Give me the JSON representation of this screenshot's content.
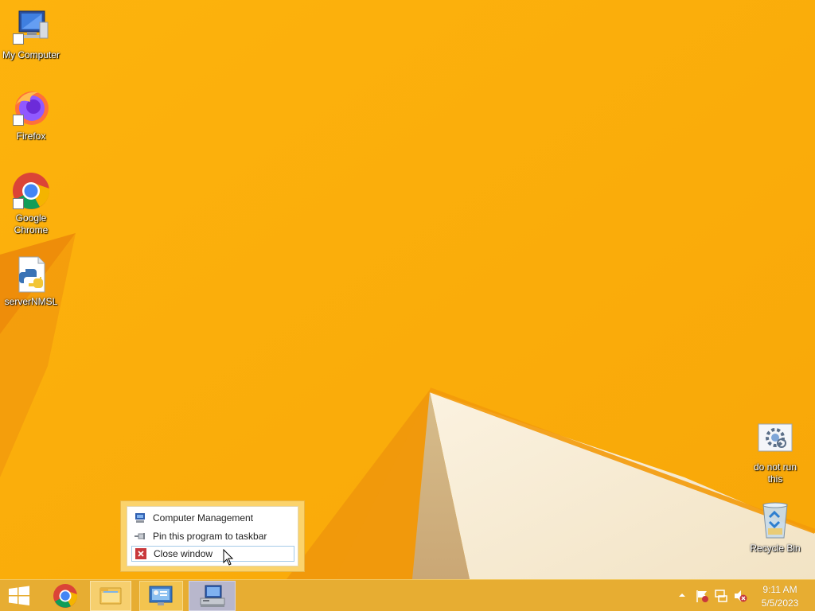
{
  "desktop": {
    "icons": [
      {
        "label": "My Computer",
        "icon": "computer-icon"
      },
      {
        "label": "Firefox",
        "icon": "firefox-icon"
      },
      {
        "label": "Google Chrome",
        "icon": "chrome-icon"
      },
      {
        "label": "serverNMSL",
        "icon": "python-file-icon"
      },
      {
        "label": "do not run this",
        "icon": "settings-file-icon"
      },
      {
        "label": "Recycle Bin",
        "icon": "recycle-bin-icon"
      }
    ]
  },
  "jumplist": {
    "items": [
      {
        "label": "Computer Management",
        "icon": "computer-management-icon"
      },
      {
        "label": "Pin this program to taskbar",
        "icon": "pin-icon"
      },
      {
        "label": "Close window",
        "icon": "close-icon"
      }
    ]
  },
  "taskbar": {
    "buttons": [
      {
        "name": "start",
        "icon": "windows-logo-icon"
      },
      {
        "name": "chrome",
        "icon": "chrome-icon"
      },
      {
        "name": "file-explorer",
        "icon": "folder-icon"
      },
      {
        "name": "control-panel",
        "icon": "control-panel-icon"
      },
      {
        "name": "computer-management",
        "icon": "computer-management-icon"
      }
    ],
    "tray": {
      "icons": [
        "show-hidden-icons-icon",
        "action-center-flag-icon",
        "network-icon",
        "volume-muted-icon"
      ],
      "time": "9:11 AM",
      "date": "5/5/2023"
    }
  },
  "colors": {
    "wallpaper": "#fdb20f",
    "taskbar": "#e7ad32",
    "menu_hover_border": "#a6cbe8"
  }
}
